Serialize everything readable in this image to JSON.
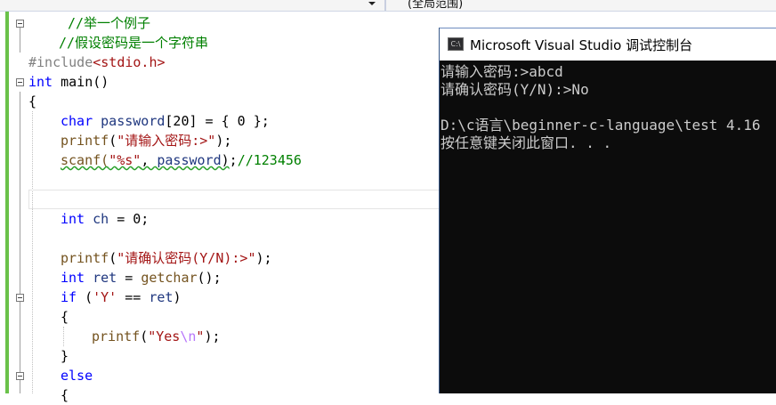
{
  "toolbar": {
    "scope_label": "(全局范围)"
  },
  "editor": {
    "lines": [
      {
        "parts": [
          {
            "t": "//举一个例子",
            "c": "cmt"
          }
        ]
      },
      {
        "parts": [
          {
            "t": "//假设密码是一个字符串",
            "c": "cmt"
          }
        ]
      },
      {
        "parts": [
          {
            "t": "#include",
            "c": "pp"
          },
          {
            "t": "<stdio.h>",
            "c": "inc"
          }
        ]
      },
      {
        "parts": [
          {
            "t": "int",
            "c": "kw"
          },
          {
            "t": " main()",
            "c": ""
          }
        ]
      },
      {
        "parts": [
          {
            "t": "{",
            "c": ""
          }
        ]
      },
      {
        "parts": [
          {
            "t": "char",
            "c": "kw"
          },
          {
            "t": " ",
            "c": ""
          },
          {
            "t": "password",
            "c": "var"
          },
          {
            "t": "[20] = { 0 };",
            "c": ""
          }
        ]
      },
      {
        "parts": [
          {
            "t": "printf",
            "c": "fn"
          },
          {
            "t": "(",
            "c": ""
          },
          {
            "t": "\"请输入密码:>\"",
            "c": "str"
          },
          {
            "t": ");",
            "c": ""
          }
        ]
      },
      {
        "parts": [
          {
            "t": "scanf(",
            "c": "fn squig"
          },
          {
            "t": "\"%s\"",
            "c": "str squig"
          },
          {
            "t": ", ",
            "c": "squig"
          },
          {
            "t": "password",
            "c": "var squig"
          },
          {
            "t": ")",
            "c": "squig"
          },
          {
            "t": ";",
            "c": ""
          },
          {
            "t": "//123456",
            "c": "cmt"
          }
        ]
      },
      {
        "parts": []
      },
      {
        "parts": []
      },
      {
        "parts": [
          {
            "t": "int",
            "c": "kw"
          },
          {
            "t": " ",
            "c": ""
          },
          {
            "t": "ch",
            "c": "var"
          },
          {
            "t": " = 0;",
            "c": ""
          }
        ]
      },
      {
        "parts": []
      },
      {
        "parts": [
          {
            "t": "printf",
            "c": "fn"
          },
          {
            "t": "(",
            "c": ""
          },
          {
            "t": "\"请确认密码(Y/N):>\"",
            "c": "str"
          },
          {
            "t": ");",
            "c": ""
          }
        ]
      },
      {
        "parts": [
          {
            "t": "int",
            "c": "kw"
          },
          {
            "t": " ",
            "c": ""
          },
          {
            "t": "ret",
            "c": "var"
          },
          {
            "t": " = ",
            "c": ""
          },
          {
            "t": "getchar",
            "c": "fn"
          },
          {
            "t": "();",
            "c": ""
          }
        ]
      },
      {
        "parts": [
          {
            "t": "if",
            "c": "kw"
          },
          {
            "t": " (",
            "c": ""
          },
          {
            "t": "'Y'",
            "c": "str"
          },
          {
            "t": " == ",
            "c": ""
          },
          {
            "t": "ret",
            "c": "var"
          },
          {
            "t": ")",
            "c": ""
          }
        ]
      },
      {
        "parts": [
          {
            "t": "{",
            "c": ""
          }
        ]
      },
      {
        "parts": [
          {
            "t": "printf",
            "c": "fn"
          },
          {
            "t": "(",
            "c": ""
          },
          {
            "t": "\"Yes",
            "c": "str"
          },
          {
            "t": "\\n",
            "c": "esc"
          },
          {
            "t": "\"",
            "c": "str"
          },
          {
            "t": ");",
            "c": ""
          }
        ]
      },
      {
        "parts": [
          {
            "t": "}",
            "c": ""
          }
        ]
      },
      {
        "parts": [
          {
            "t": "else",
            "c": "kw"
          }
        ]
      },
      {
        "parts": [
          {
            "t": "{",
            "c": ""
          }
        ]
      }
    ]
  },
  "console": {
    "icon_text": "C:\\",
    "title": "Microsoft Visual Studio 调试控制台",
    "output": [
      "请输入密码:>abcd",
      "请确认密码(Y/N):>No",
      "",
      "D:\\c语言\\beginner-c-language\\test 4.16",
      "按任意键关闭此窗口. . ."
    ]
  }
}
